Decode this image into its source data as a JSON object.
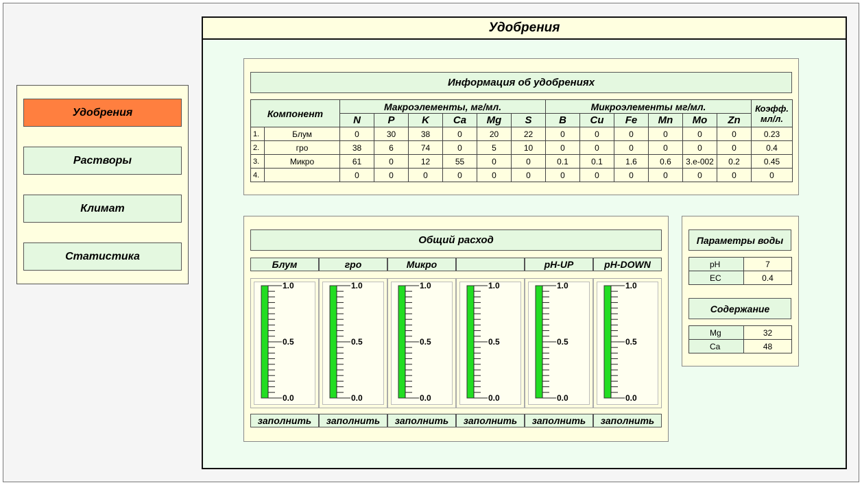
{
  "nav": [
    {
      "label": "Удобрения",
      "active": true
    },
    {
      "label": "Растворы",
      "active": false
    },
    {
      "label": "Климат",
      "active": false
    },
    {
      "label": "Статистика",
      "active": false
    }
  ],
  "main": {
    "title": "Удобрения"
  },
  "info": {
    "title": "Информация об удобрениях",
    "component_header": "Компонент",
    "macro_header": "Макроэлементы, мг/мл.",
    "micro_header": "Микроэлементы мг/мл.",
    "coef_header": "Коэфф. мл/л.",
    "macro_cols": [
      "N",
      "P",
      "K",
      "Ca",
      "Mg",
      "S"
    ],
    "micro_cols": [
      "B",
      "Cu",
      "Fe",
      "Mn",
      "Mo",
      "Zn"
    ],
    "rows": [
      {
        "idx": "1.",
        "name": "Блум",
        "values": [
          "0",
          "30",
          "38",
          "0",
          "20",
          "22",
          "0",
          "0",
          "0",
          "0",
          "0",
          "0",
          "0.23"
        ]
      },
      {
        "idx": "2.",
        "name": "гро",
        "values": [
          "38",
          "6",
          "74",
          "0",
          "5",
          "10",
          "0",
          "0",
          "0",
          "0",
          "0",
          "0",
          "0.4"
        ]
      },
      {
        "idx": "3.",
        "name": "Микро",
        "values": [
          "61",
          "0",
          "12",
          "55",
          "0",
          "0",
          "0.1",
          "0.1",
          "1.6",
          "0.6",
          "3.e-002",
          "0.2",
          "0.45"
        ]
      },
      {
        "idx": "4.",
        "name": "",
        "values": [
          "0",
          "0",
          "0",
          "0",
          "0",
          "0",
          "0",
          "0",
          "0",
          "0",
          "0",
          "0",
          "0"
        ]
      }
    ]
  },
  "consumption": {
    "title": "Общий расход",
    "columns": [
      "Блум",
      "гро",
      "Микро",
      "",
      "pH-UP",
      "pH-DOWN"
    ],
    "fill_label": "заполнить",
    "scale_labels": [
      "1.0",
      "0.5",
      "0.0"
    ],
    "levels": [
      1.0,
      1.0,
      1.0,
      1.0,
      1.0,
      1.0
    ],
    "bar_color": "#22dd22"
  },
  "water": {
    "title": "Параметры воды",
    "params": [
      {
        "key": "pH",
        "value": "7"
      },
      {
        "key": "EC",
        "value": "0.4"
      }
    ],
    "content_title": "Содержание",
    "content": [
      {
        "key": "Mg",
        "value": "32"
      },
      {
        "key": "Ca",
        "value": "48"
      }
    ]
  }
}
